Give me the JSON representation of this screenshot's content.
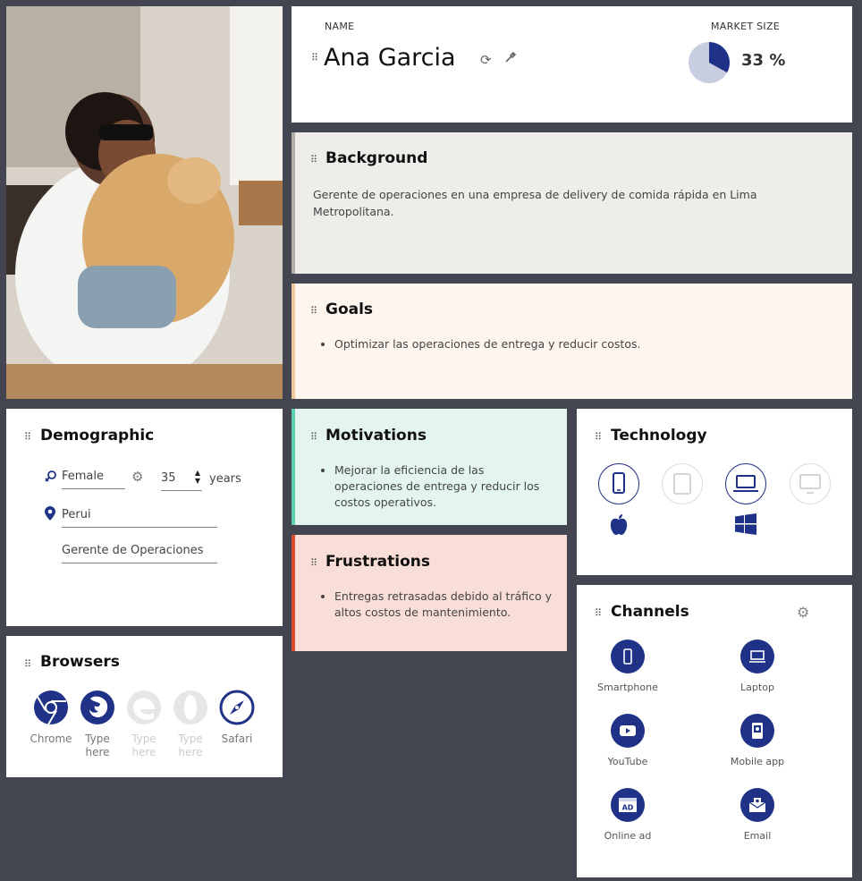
{
  "header": {
    "name_label": "NAME",
    "name": "Ana Garcia",
    "market_label": "MARKET SIZE",
    "market_size_percent": 33,
    "market_size_text": "33 %"
  },
  "photo": {
    "description_icon": "persona-photo"
  },
  "background": {
    "title": "Background",
    "text": "Gerente de operaciones en una empresa de delivery de comida rápida en Lima Metropolitana."
  },
  "goals": {
    "title": "Goals",
    "items": [
      "Optimizar las operaciones de entrega y reducir costos."
    ]
  },
  "demographic": {
    "title": "Demographic",
    "gender": "Female",
    "age": "35",
    "age_unit": "years",
    "location": "Perui",
    "occupation": "Gerente de Operaciones"
  },
  "motivations": {
    "title": "Motivations",
    "items": [
      "Mejorar la eficiencia de las operaciones de entrega y reducir los costos operativos."
    ]
  },
  "frustrations": {
    "title": "Frustrations",
    "items": [
      "Entregas retrasadas debido al tráfico y altos costos de mantenimiento."
    ]
  },
  "technology": {
    "title": "Technology",
    "devices": [
      {
        "icon": "smartphone-icon",
        "active": true
      },
      {
        "icon": "tablet-icon",
        "active": false
      },
      {
        "icon": "laptop-icon",
        "active": true
      },
      {
        "icon": "desktop-icon",
        "active": false
      }
    ],
    "os": [
      "apple-icon",
      "windows-icon"
    ]
  },
  "browsers": {
    "title": "Browsers",
    "items": [
      {
        "label": "Chrome",
        "icon": "chrome-icon",
        "active": true
      },
      {
        "label": "Type here",
        "icon": "firefox-icon",
        "active": true
      },
      {
        "label": "Type here",
        "icon": "edge-icon",
        "active": false
      },
      {
        "label": "Type here",
        "icon": "opera-icon",
        "active": false
      },
      {
        "label": "Safari",
        "icon": "safari-icon",
        "active": true
      }
    ]
  },
  "channels": {
    "title": "Channels",
    "items": [
      {
        "label": "Smartphone",
        "icon": "smartphone-icon"
      },
      {
        "label": "Laptop",
        "icon": "laptop-icon"
      },
      {
        "label": "YouTube",
        "icon": "youtube-icon"
      },
      {
        "label": "Mobile app",
        "icon": "mobile-app-icon"
      },
      {
        "label": "Online ad",
        "icon": "online-ad-icon"
      },
      {
        "label": "Email",
        "icon": "email-icon"
      }
    ]
  },
  "colors": {
    "page_bg": "#434650",
    "accent": "#1f3287",
    "background_card": "#efedea",
    "goals_card": "#fdf5ee",
    "goals_border": "#f0c9a1",
    "motivations_card": "#e4f5f0",
    "motivations_border": "#5ccfb0",
    "frustrations_card": "#f9ddd7",
    "frustrations_border": "#d94c2e"
  }
}
